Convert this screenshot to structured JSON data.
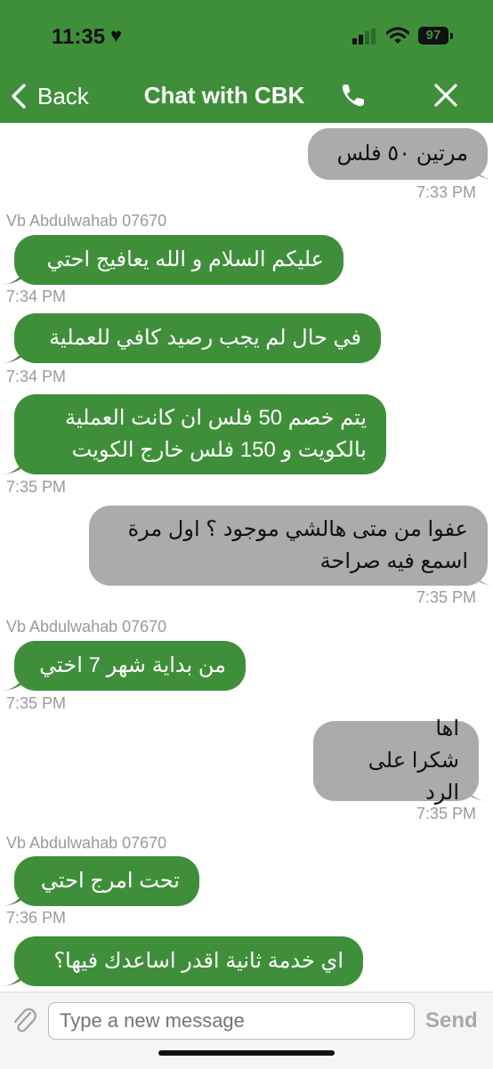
{
  "status_bar": {
    "time": "11:35",
    "battery": "97"
  },
  "nav": {
    "back_label": "Back",
    "title": "Chat with CBK"
  },
  "messages": [
    {
      "dir": "out",
      "text": "مرتين ٥٠ فلس",
      "time": "7:33 PM"
    },
    {
      "dir": "in",
      "sender": "Vb Abdulwahab 07670",
      "text": "عليكم السلام و الله يعافيج احتي",
      "time": "7:34 PM"
    },
    {
      "dir": "in",
      "text": "في حال لم يجب رصيد كافي للعملية",
      "time": "7:34 PM"
    },
    {
      "dir": "in",
      "text": "يتم خصم 50 فلس ان كانت العملية\nبالكويت و 150 فلس خارج الكويت",
      "time": "7:35 PM"
    },
    {
      "dir": "out",
      "text": "عفوا من متى هالشي موجود ؟ اول مرة\nاسمع فيه صراحة",
      "time": "7:35 PM"
    },
    {
      "dir": "in",
      "sender": "Vb Abdulwahab 07670",
      "text": "من بداية شهر 7 اختي",
      "time": "7:35 PM"
    },
    {
      "dir": "out",
      "text": "اها\nشكرا على الرد",
      "time": "7:35 PM"
    },
    {
      "dir": "in",
      "sender": "Vb Abdulwahab 07670",
      "text": "تحت امرج احتي",
      "time": "7:36 PM"
    },
    {
      "dir": "in",
      "text": "اي خدمة ثانية اقدر اساعدك فيها؟",
      "time": ""
    }
  ],
  "composer": {
    "placeholder": "Type a new message",
    "send_label": "Send"
  },
  "colors": {
    "brand_green": "#3f8f3a",
    "outgoing_gray": "#ababab"
  },
  "icons": [
    "heart-icon",
    "signal-icon",
    "wifi-icon",
    "battery-icon",
    "back-chevron-icon",
    "phone-icon",
    "close-icon",
    "paperclip-icon"
  ]
}
